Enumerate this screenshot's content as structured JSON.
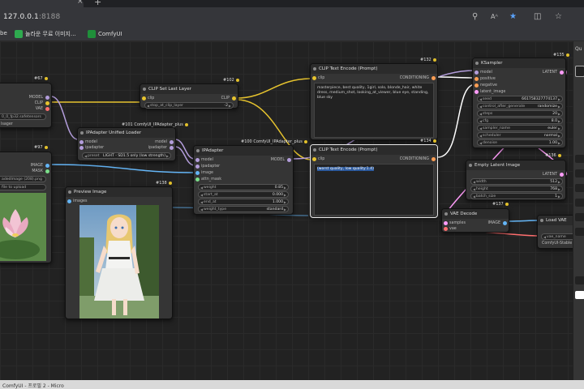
{
  "browser": {
    "tab_title": "ComfyUI",
    "url_host": "127.0.0.1",
    "url_port": ":8188",
    "bookmarks": [
      {
        "label": "be",
        "color": "#c0392b"
      },
      {
        "label": "놀라운 무료 이미지...",
        "color": "#2eaa4f"
      },
      {
        "label": "ComfyUI",
        "color": "#1f8f3a"
      }
    ]
  },
  "nodes": {
    "checkpoint": {
      "id": "#67",
      "outputs": [
        "MODEL",
        "CLIP",
        "VAE"
      ],
      "ckpt_value": "0_0_fp32.safetensors",
      "extra": "lsager"
    },
    "load_image": {
      "id": "#97",
      "outputs": [
        "IMAGE",
        "MASK"
      ],
      "file": "adedImage (208).png",
      "upload": "file to upload"
    },
    "clip_set_last_layer": {
      "id": "#102",
      "title": "CLIP Set Last Layer",
      "input": "clip",
      "output": "CLIP",
      "widget_label": "stop_at_clip_layer",
      "widget_value": "-2"
    },
    "ipadapter_loader": {
      "id": "#101 ComfyUI_IPAdapter_plus",
      "title": "IPAdapter Unified Loader",
      "inputs": [
        "model",
        "ipadapter"
      ],
      "outputs": [
        "model",
        "ipadapter"
      ],
      "preset_label": "preset",
      "preset_value": "LIGHT - SD1.5 only (low strength)"
    },
    "ipadapter": {
      "id": "#100 ComfyUI_IPAdapter_plus",
      "title": "IPAdapter",
      "inputs": [
        "model",
        "ipadapter",
        "image",
        "attn_mask"
      ],
      "output": "MODEL",
      "widgets": [
        {
          "label": "weight",
          "value": "0.85"
        },
        {
          "label": "start_at",
          "value": "0.000"
        },
        {
          "label": "end_at",
          "value": "1.000"
        },
        {
          "label": "weight_type",
          "value": "standard"
        }
      ]
    },
    "preview": {
      "id": "#138",
      "title": "Preview Image",
      "input": "images"
    },
    "clip_pos": {
      "id": "#132",
      "title": "CLIP Text Encode (Prompt)",
      "input": "clip",
      "output": "CONDITIONING",
      "text": "masterpiece, best quality, 1girl, solo, blonde_hair, white dress, medium_shot, looking_at_viewer, blue eye, standing, blue sky"
    },
    "clip_neg": {
      "id": "#134",
      "title": "CLIP Text Encode (Prompt)",
      "input": "clip",
      "output": "CONDITIONING",
      "text": "(worst quality, low quality:1.4)"
    },
    "ksampler": {
      "id": "#135",
      "title": "KSampler",
      "inputs": [
        "model",
        "positive",
        "negative",
        "latent_image"
      ],
      "output": "LATENT",
      "widgets": [
        {
          "label": "seed",
          "value": "661758327774137"
        },
        {
          "label": "control_after_generate",
          "value": "randomize"
        },
        {
          "label": "steps",
          "value": "20"
        },
        {
          "label": "cfg",
          "value": "8.0"
        },
        {
          "label": "sampler_name",
          "value": "euler"
        },
        {
          "label": "scheduler",
          "value": "normal"
        },
        {
          "label": "denoise",
          "value": "1.00"
        }
      ]
    },
    "empty_latent": {
      "id": "#136",
      "title": "Empty Latent Image",
      "output": "LATENT",
      "widgets": [
        {
          "label": "width",
          "value": "512"
        },
        {
          "label": "height",
          "value": "768"
        },
        {
          "label": "batch_size",
          "value": "1"
        }
      ]
    },
    "vae_decode": {
      "id": "#137",
      "title": "VAE Decode",
      "inputs": [
        "samples",
        "vae"
      ],
      "output": "IMAGE"
    },
    "load_vae": {
      "title": "Load VAE",
      "vae_name_label": "vae_name",
      "vae_name_value": "ComfyUI-Stable"
    }
  },
  "right_panel": {
    "queue_label": "Qu"
  },
  "statusbar": {
    "text": "ComfyUI - 프로필 2 - Micro"
  },
  "colors": {
    "clip": "#e6c32e",
    "model": "#b39ddb",
    "conditioning": "#ffffff",
    "latent": "#ff9cf9",
    "image": "#64b5f6",
    "vae": "#ff6e6e"
  }
}
